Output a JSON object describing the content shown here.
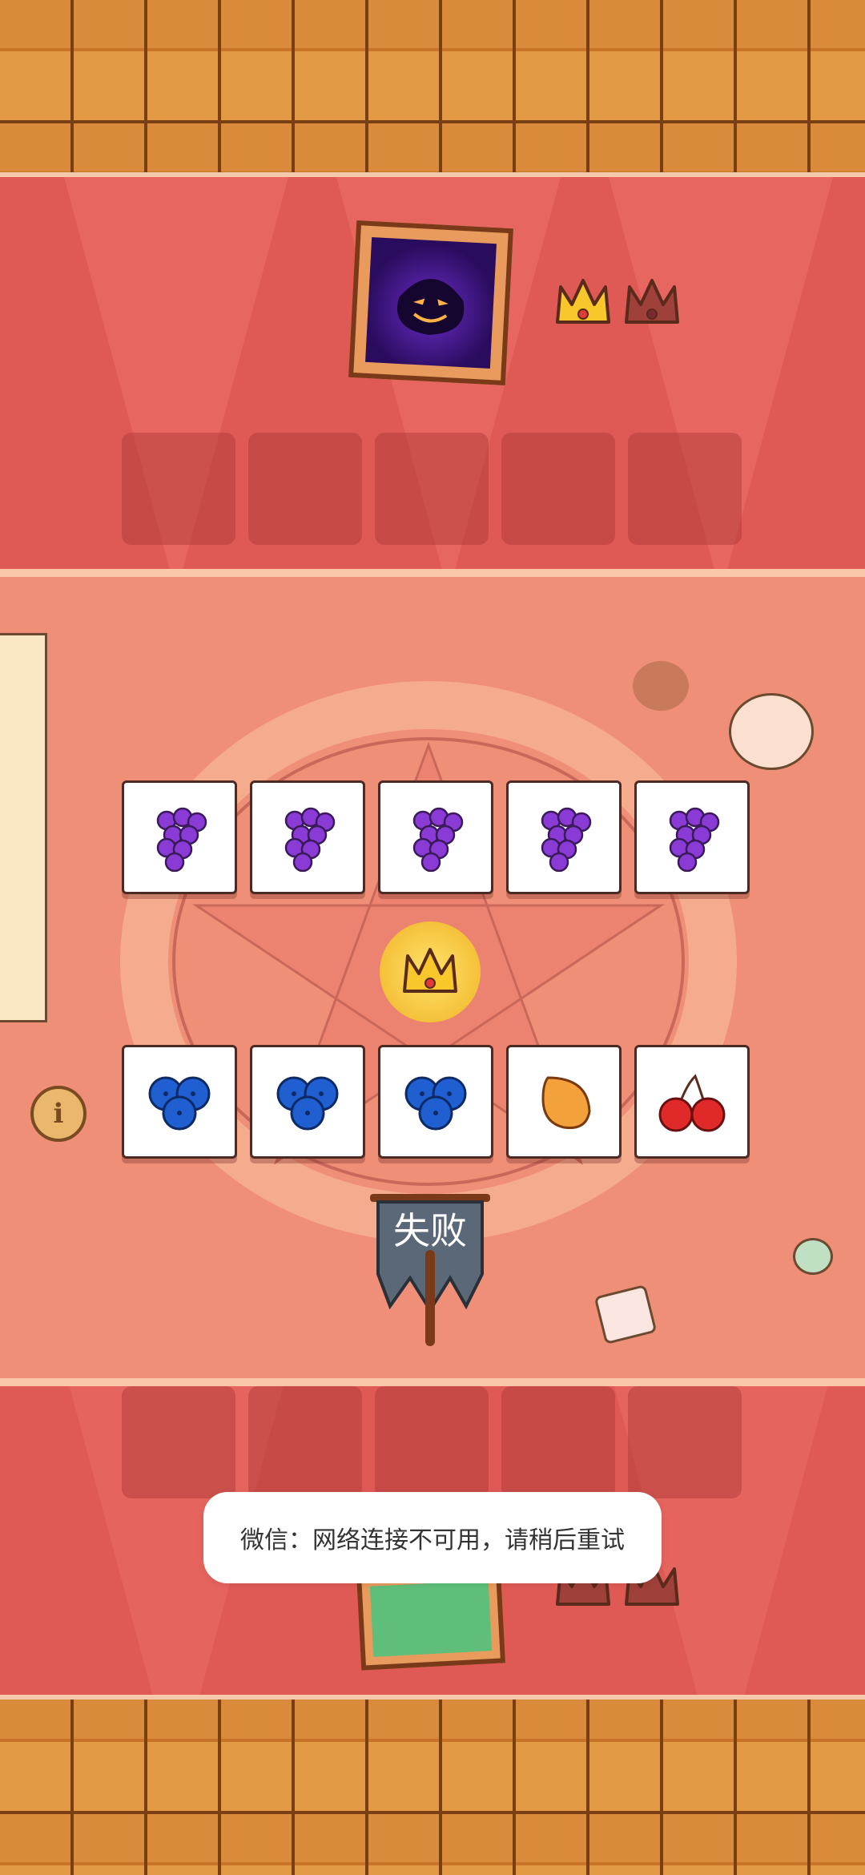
{
  "game": {
    "result_label": "失败",
    "toast_message": "微信：网络连接不可用，请稍后重试",
    "opponent": {
      "avatar": "shadow-monster",
      "crowns_won": 1,
      "crowns_total": 2
    },
    "player": {
      "avatar": "green-character",
      "crowns_won": 0,
      "crowns_total": 2
    },
    "opponent_cards": [
      "grape",
      "grape",
      "grape",
      "grape",
      "grape"
    ],
    "player_cards": [
      "blueberry",
      "blueberry",
      "blueberry",
      "orange",
      "cherry"
    ],
    "center_icon": "crown-icon",
    "info_icon": "info-icon"
  },
  "colors": {
    "crown_active": "#f7c72b",
    "crown_inactive": "#a0403a",
    "grape": "#8a3bd6",
    "blueberry": "#1f5fd1",
    "orange": "#f2a13b",
    "cherry": "#e02a2a",
    "banner": "#5b6878"
  }
}
